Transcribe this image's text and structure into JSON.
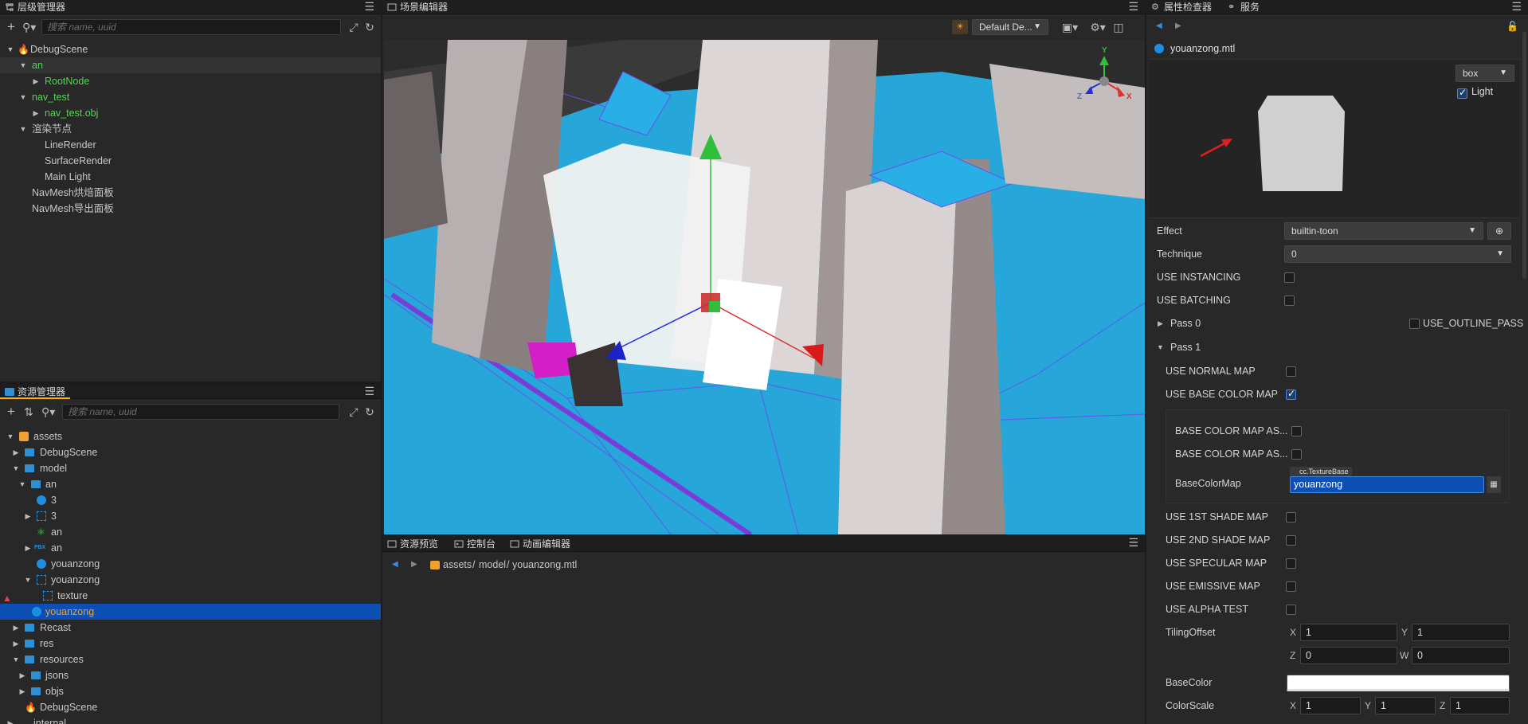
{
  "hierarchy": {
    "title": "层级管理器",
    "search_placeholder": "搜索 name, uuid",
    "nodes": [
      {
        "label": "DebugScene"
      },
      {
        "label": "an"
      },
      {
        "label": "RootNode"
      },
      {
        "label": "nav_test"
      },
      {
        "label": "nav_test.obj"
      },
      {
        "label": "渲染节点"
      },
      {
        "label": "LineRender"
      },
      {
        "label": "SurfaceRender"
      },
      {
        "label": "Main Light"
      },
      {
        "label": "NavMesh烘焙面板"
      },
      {
        "label": "NavMesh导出面板"
      }
    ]
  },
  "assets": {
    "title": "资源管理器",
    "search_placeholder": "搜索 name, uuid",
    "nodes": [
      {
        "label": "assets"
      },
      {
        "label": "DebugScene"
      },
      {
        "label": "model"
      },
      {
        "label": "an"
      },
      {
        "label": "3"
      },
      {
        "label": "3"
      },
      {
        "label": "an"
      },
      {
        "label": "an",
        "badge": "FBX"
      },
      {
        "label": "youanzong"
      },
      {
        "label": "youanzong"
      },
      {
        "label": "texture"
      },
      {
        "label": "youanzong"
      },
      {
        "label": "Recast"
      },
      {
        "label": "res"
      },
      {
        "label": "resources"
      },
      {
        "label": "jsons"
      },
      {
        "label": "objs"
      },
      {
        "label": "DebugScene"
      },
      {
        "label": "internal"
      }
    ]
  },
  "scene": {
    "title": "场景编辑器",
    "camera_select": "Default De...",
    "gizmo_axes": {
      "x": "X",
      "y": "Y",
      "z": "Z"
    }
  },
  "bottom": {
    "tabs": [
      {
        "label": "资源预览"
      },
      {
        "label": "控制台"
      },
      {
        "label": "动画编辑器"
      }
    ],
    "breadcrumb": [
      "assets",
      "model",
      "youanzong.mtl"
    ]
  },
  "inspector": {
    "tabs": [
      {
        "label": "属性检查器"
      },
      {
        "label": "服务"
      }
    ],
    "asset_name": "youanzong.mtl",
    "preview": {
      "shape": "box",
      "light_label": "Light",
      "light_checked": true
    },
    "effect": {
      "label": "Effect",
      "value": "builtin-toon"
    },
    "technique": {
      "label": "Technique",
      "value": "0"
    },
    "use_instancing": {
      "label": "USE INSTANCING",
      "checked": false
    },
    "use_batching": {
      "label": "USE BATCHING",
      "checked": false
    },
    "pass0": {
      "label": "Pass 0",
      "outline_label": "USE_OUTLINE_PASS",
      "outline_checked": false
    },
    "pass1": {
      "label": "Pass 1"
    },
    "pass1_props": [
      {
        "label": "USE NORMAL MAP",
        "checked": false
      },
      {
        "label": "USE BASE COLOR MAP",
        "checked": true
      }
    ],
    "nested": [
      {
        "label": "BASE COLOR MAP AS...",
        "checked": false
      },
      {
        "label": "BASE COLOR MAP AS...",
        "checked": false
      }
    ],
    "basecolormap": {
      "label": "BaseColorMap",
      "type_badge": "cc.TextureBase",
      "value": "youanzong"
    },
    "pass1_props2": [
      {
        "label": "USE 1ST SHADE MAP",
        "checked": false
      },
      {
        "label": "USE 2ND SHADE MAP",
        "checked": false
      },
      {
        "label": "USE SPECULAR MAP",
        "checked": false
      },
      {
        "label": "USE EMISSIVE MAP",
        "checked": false
      },
      {
        "label": "USE ALPHA TEST",
        "checked": false
      }
    ],
    "tiling": {
      "label": "TilingOffset",
      "x_label": "X",
      "x": "1",
      "y_label": "Y",
      "y": "1",
      "z_label": "Z",
      "z": "0",
      "w_label": "W",
      "w": "0"
    },
    "basecolor": {
      "label": "BaseColor",
      "color": "#ffffff"
    },
    "colorscale": {
      "label": "ColorScale",
      "x_label": "X",
      "x": "1",
      "y_label": "Y",
      "y": "1",
      "z_label": "Z",
      "z": "1"
    }
  },
  "colors": {
    "accent": "#0d4fb5",
    "tab_active": "#ffb400",
    "node_green": "#4dd94d",
    "warning": "#f0a030",
    "navmesh": "#1aa8dd"
  }
}
